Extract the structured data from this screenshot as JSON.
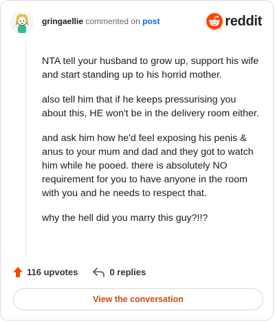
{
  "comment": {
    "username": "gringaellie",
    "action_text": "commented on",
    "post_link": "post",
    "paragraphs": [
      "NTA tell your husband to grow up, support his wife and start standing up to his horrid mother.",
      "also tell him that if he keeps pressurising you about this, HE won't be in the delivery room either.",
      "and ask him how he'd feel exposing his penis & anus to your mum and dad and they got to watch him while he pooed. there is absolutely NO requirement for you to have anyone in the room with you and he needs to respect that.",
      "why the hell did you marry this guy?!!?"
    ]
  },
  "brand": {
    "name": "reddit",
    "accent": "#ff4500"
  },
  "actions": {
    "upvotes": "116 upvotes",
    "replies": "0 replies"
  },
  "cta": {
    "label": "View the conversation",
    "color": "#d24a12"
  },
  "icons": {
    "avatar": "avatar-icon",
    "logo": "reddit-logo-icon",
    "upvote": "upvote-arrow-icon",
    "reply": "reply-arrow-icon"
  }
}
